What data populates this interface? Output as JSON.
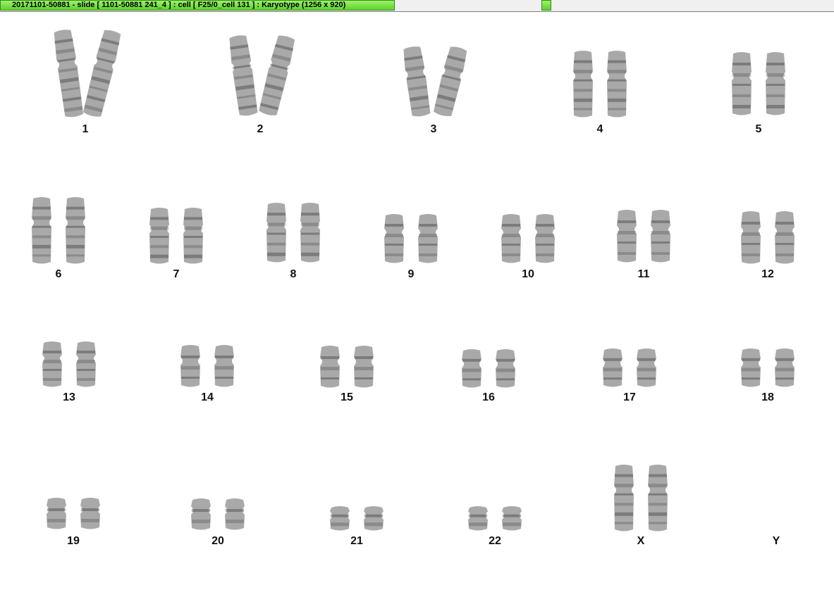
{
  "window": {
    "title": "20171101-50881 - slide [ 1101-50881 241_4 ] : cell [ F25/0_cell 131 ] : Karyotype  (1256 x 920)"
  },
  "karyotype": {
    "chromosomes": [
      {
        "label": "1"
      },
      {
        "label": "2"
      },
      {
        "label": "3"
      },
      {
        "label": "4"
      },
      {
        "label": "5"
      },
      {
        "label": "6"
      },
      {
        "label": "7"
      },
      {
        "label": "8"
      },
      {
        "label": "9"
      },
      {
        "label": "10"
      },
      {
        "label": "11"
      },
      {
        "label": "12"
      },
      {
        "label": "13"
      },
      {
        "label": "14"
      },
      {
        "label": "15"
      },
      {
        "label": "16"
      },
      {
        "label": "17"
      },
      {
        "label": "18"
      },
      {
        "label": "19"
      },
      {
        "label": "20"
      },
      {
        "label": "21"
      },
      {
        "label": "22"
      },
      {
        "label": "X"
      },
      {
        "label": "Y"
      }
    ]
  },
  "colors": {
    "tab_accent": "#5fd12e",
    "chromosome_gray": "#9a9a9a"
  }
}
